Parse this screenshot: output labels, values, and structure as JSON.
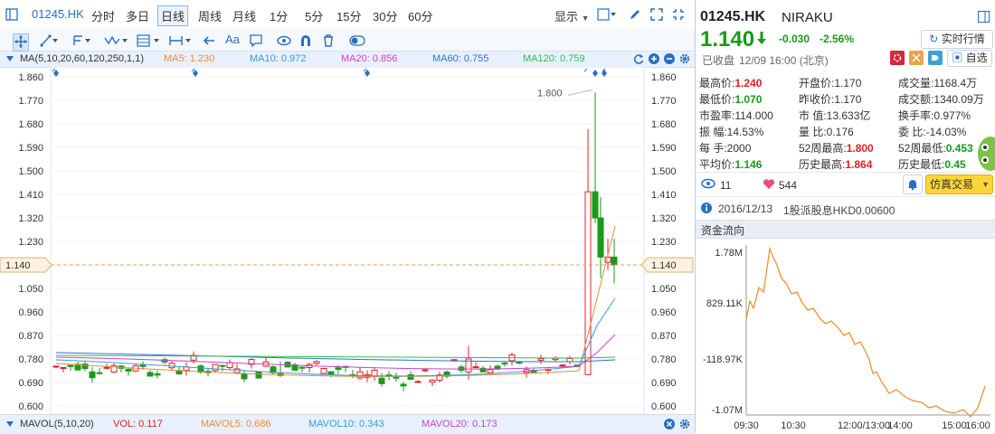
{
  "toolbar": {
    "code": "01245.HK",
    "periods": [
      "分时",
      "多日",
      "日线",
      "周线",
      "月线",
      "1分",
      "5分",
      "15分",
      "30分",
      "60分"
    ],
    "active_period": "日线",
    "display_label": "显示"
  },
  "ma_bar": {
    "label": "MA(5,10,20,60,120,250,1,1)",
    "items": [
      {
        "text": "MA5: 1.230",
        "color": "#f0883a"
      },
      {
        "text": "MA10: 0.972",
        "color": "#3a9be0"
      },
      {
        "text": "MA20: 0.856",
        "color": "#d040c8"
      },
      {
        "text": "MA60: 0.755",
        "color": "#3070d8"
      },
      {
        "text": "MA120: 0.759",
        "color": "#30c050"
      }
    ]
  },
  "chart_data": {
    "type": "candlestick",
    "y_ticks": [
      "1.860",
      "1.770",
      "1.680",
      "1.590",
      "1.500",
      "1.410",
      "1.320",
      "1.230",
      "1.140",
      "1.050",
      "0.960",
      "0.870",
      "0.780",
      "0.690",
      "0.600"
    ],
    "ylim": [
      0.6,
      1.86
    ],
    "current_price": "1.140",
    "peak_label": "1.800",
    "up_color": "#e02020",
    "down_color": "#1a9a1a"
  },
  "vol_bar": {
    "label": "MAVOL(5,10,20)",
    "items": [
      {
        "text": "VOL: 0.117",
        "color": "#e02020"
      },
      {
        "text": "MAVOL5: 0.686",
        "color": "#f0883a"
      },
      {
        "text": "MAVOL10: 0.343",
        "color": "#3a9be0"
      },
      {
        "text": "MAVOL20: 0.173",
        "color": "#d040c8"
      }
    ]
  },
  "quote": {
    "code": "01245.HK",
    "name": "NIRAKU",
    "price": "1.140",
    "change": "-0.030",
    "change_pct": "-2.56%",
    "realtime_button": "实时行情",
    "status": "已收盘",
    "time": "12/09 16:00 (北京)",
    "watchlist_button": "自选",
    "fields": [
      {
        "label": "最高价:",
        "value": "1.240",
        "cls": "red"
      },
      {
        "label": "开盘价:",
        "value": "1.170",
        "cls": ""
      },
      {
        "label": "成交量:",
        "value": "1168.4万",
        "cls": ""
      },
      {
        "label": "最低价:",
        "value": "1.070",
        "cls": "green"
      },
      {
        "label": "昨收价:",
        "value": "1.170",
        "cls": ""
      },
      {
        "label": "成交额:",
        "value": "1340.09万",
        "cls": ""
      },
      {
        "label": "市盈率:",
        "value": "114.000",
        "cls": ""
      },
      {
        "label": "市 值:",
        "value": "13.633亿",
        "cls": ""
      },
      {
        "label": "换手率:",
        "value": "0.977%",
        "cls": ""
      },
      {
        "label": "振 幅:",
        "value": "14.53%",
        "cls": ""
      },
      {
        "label": "量 比:",
        "value": "0.176",
        "cls": ""
      },
      {
        "label": "委 比:",
        "value": "-14.03%",
        "cls": ""
      },
      {
        "label": "每 手:",
        "value": "2000",
        "cls": ""
      },
      {
        "label": "52周最高:",
        "value": "1.800",
        "cls": "red"
      },
      {
        "label": "52周最低:",
        "value": "0.453",
        "cls": "green"
      },
      {
        "label": "平均价:",
        "value": "1.146",
        "cls": "green"
      },
      {
        "label": "历史最高:",
        "value": "1.864",
        "cls": "red"
      },
      {
        "label": "历史最低:",
        "value": "0.45",
        "cls": "green"
      }
    ],
    "views": "11",
    "likes": "544",
    "trade_button": "仿真交易",
    "dividend_date": "2016/12/13",
    "dividend_text": "1股派股息HKD0.00600"
  },
  "flow": {
    "title": "资金流向",
    "y_labels": [
      "1.78M",
      "829.11K",
      "-118.97K",
      "-1.07M"
    ],
    "x_labels": [
      "09:30",
      "10:30",
      "12:00/13:00",
      "14:00",
      "15:00",
      "16:00"
    ],
    "ylim": [
      -1.07,
      1.78
    ],
    "line_color": "#f08a24"
  }
}
